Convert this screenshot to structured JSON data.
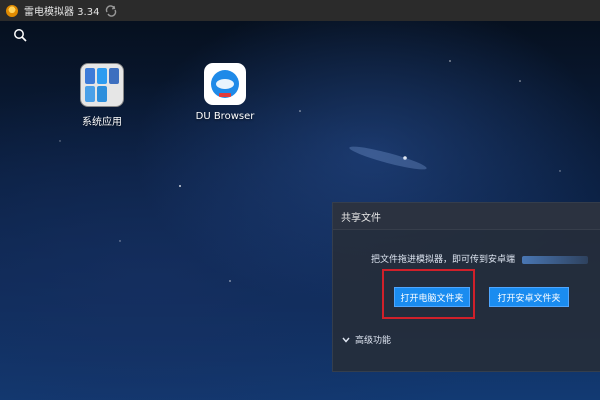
{
  "window": {
    "title": "雷电模拟器 3.34"
  },
  "desktop": {
    "apps": [
      {
        "label": "系统应用",
        "icon": "folder-icon"
      },
      {
        "label": "DU Browser",
        "icon": "browser-icon"
      }
    ]
  },
  "share_panel": {
    "title": "共享文件",
    "description": "把文件拖进模拟器，即可传到安卓端",
    "open_pc_folder_label": "打开电脑文件夹",
    "open_android_folder_label": "打开安卓文件夹",
    "advanced_label": "高级功能"
  },
  "colors": {
    "accent_blue": "#1a8cf0",
    "highlight_red": "#d0202a",
    "titlebar_bg": "#2b2b2b",
    "panel_bg": "#262d3a"
  }
}
